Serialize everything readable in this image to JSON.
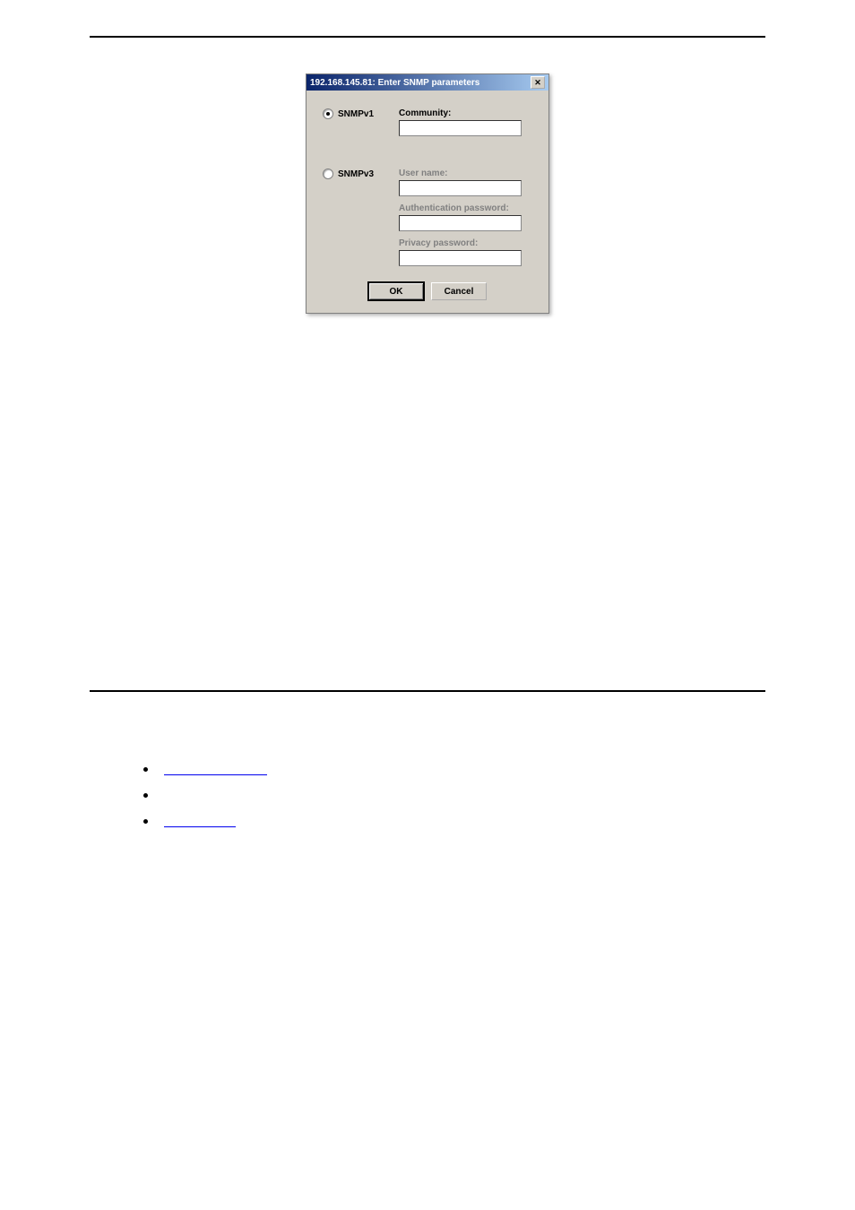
{
  "dialog": {
    "title": "192.168.145.81: Enter SNMP parameters",
    "snmpv1": {
      "radio_label": "SNMPv1",
      "community_label": "Community:"
    },
    "snmpv3": {
      "radio_label": "SNMPv3",
      "username_label": "User name:",
      "auth_label": "Authentication password:",
      "privacy_label": "Privacy password:"
    },
    "buttons": {
      "ok": "OK",
      "cancel": "Cancel"
    }
  }
}
